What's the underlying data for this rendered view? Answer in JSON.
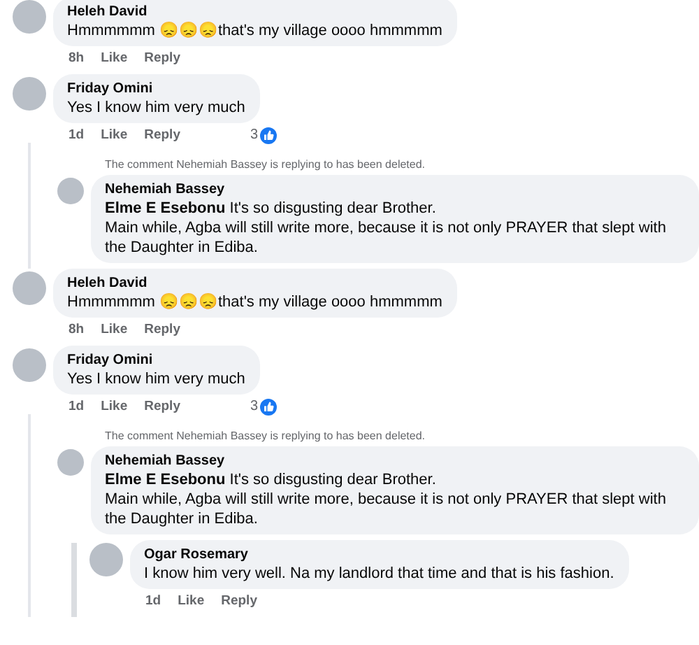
{
  "comments": [
    {
      "author": "Heleh David",
      "text": "Hmmmmmm 😞😞😞that's my village oooo hmmmmm",
      "time": "8h",
      "actions": [
        "Like",
        "Reply"
      ]
    },
    {
      "author": "Friday Omini",
      "text": "Yes I know him very much",
      "time": "1d",
      "actions": [
        "Like",
        "Reply"
      ],
      "reactions": "3",
      "replies": [
        {
          "notice": "The comment Nehemiah Bassey is replying to has been deleted.",
          "author": "Nehemiah Bassey",
          "text": "**Elme E Esebonu** It's so disgusting dear Brother.\nMain while, Agba will still write more, because it is not only PRAYER that slept with the Daughter in Ediba."
        }
      ]
    },
    {
      "author": "Heleh David",
      "text": "Hmmmmmm 😞😞😞that's my village oooo hmmmmm",
      "time": "8h",
      "actions": [
        "Like",
        "Reply"
      ]
    },
    {
      "author": "Friday Omini",
      "text": "Yes I know him very much",
      "time": "1d",
      "actions": [
        "Like",
        "Reply"
      ],
      "reactions": "3",
      "replies": [
        {
          "notice": "The comment Nehemiah Bassey is replying to has been deleted.",
          "author": "Nehemiah Bassey",
          "text": "**Elme E Esebonu** It's so disgusting dear Brother.\nMain while, Agba will still write more, because it is not only PRAYER that slept with the Daughter in Ediba.",
          "replies": [
            {
              "author": "Ogar Rosemary",
              "text": "I know him very well. Na my landlord that time and that is his fashion.",
              "time": "1d",
              "actions": [
                "Like",
                "Reply"
              ]
            }
          ]
        }
      ]
    }
  ]
}
